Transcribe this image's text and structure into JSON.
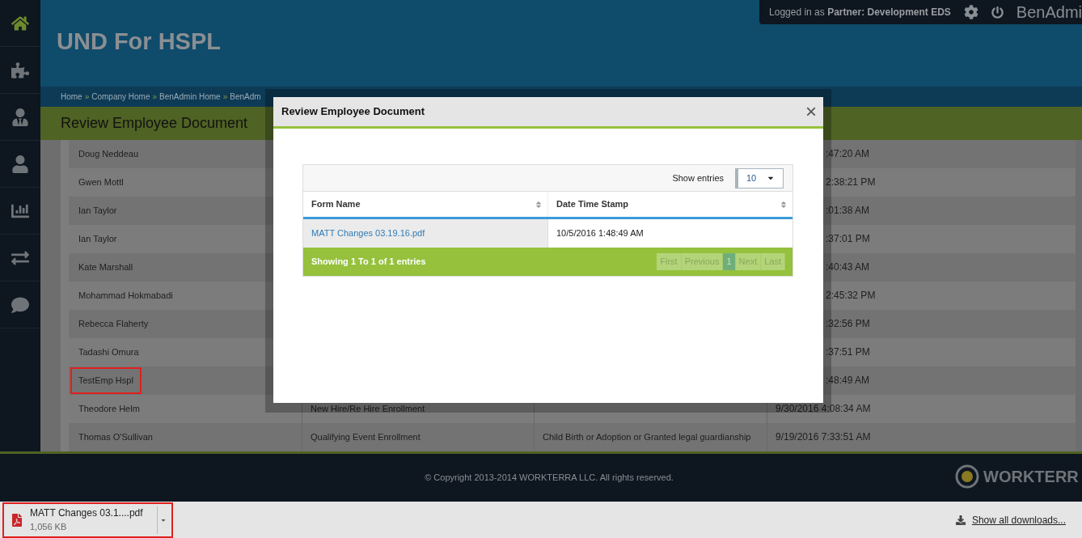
{
  "sidebar": {
    "items": [
      {
        "selected": true
      },
      {
        "selected": false
      },
      {
        "selected": false
      },
      {
        "selected": false
      },
      {
        "selected": false
      },
      {
        "selected": false
      },
      {
        "selected": false
      }
    ]
  },
  "header": {
    "title": "UND For HSPL",
    "login_prefix": "Logged in as",
    "login_role": "Partner:",
    "login_name": "Development EDS",
    "app_name": "BenAdmi"
  },
  "breadcrumb": [
    {
      "label": "Home",
      "separator": "»"
    },
    {
      "label": "Company Home",
      "separator": "»"
    },
    {
      "label": "BenAdmin Home",
      "separator": "»"
    },
    {
      "label": "BenAdm"
    }
  ],
  "page_title": "Review Employee Document",
  "table": {
    "rows": [
      {
        "name": "Doug Neddeau",
        "form": "",
        "event": "",
        "time": ":47:20 AM",
        "covered": true,
        "highlighted": false
      },
      {
        "name": "Gwen Mottl",
        "form": "",
        "event": "",
        "time": "2:38:21 PM",
        "covered": true,
        "highlighted": false
      },
      {
        "name": "Ian Taylor",
        "form": "",
        "event": "",
        "time": ":01:38 AM",
        "covered": true,
        "highlighted": false
      },
      {
        "name": "Ian Taylor",
        "form": "",
        "event": "",
        "time": ":37:01 PM",
        "covered": true,
        "highlighted": false
      },
      {
        "name": "Kate Marshall",
        "form": "",
        "event": "",
        "time": ":40:43 AM",
        "covered": true,
        "highlighted": false
      },
      {
        "name": "Mohammad Hokmabadi",
        "form": "",
        "event": "",
        "time": "2:45:32 PM",
        "covered": true,
        "highlighted": false
      },
      {
        "name": "Rebecca Flaherty",
        "form": "",
        "event": "",
        "time": ":32:56 PM",
        "covered": true,
        "highlighted": false
      },
      {
        "name": "Tadashi Omura",
        "form": "",
        "event": "",
        "time": ":37:51 PM",
        "covered": true,
        "highlighted": false
      },
      {
        "name": "TestEmp Hspl",
        "form": "",
        "event": "",
        "time": ":48:49 AM",
        "covered": true,
        "highlighted": true
      },
      {
        "name": "Theodore Helm",
        "form": "New Hire/Re Hire Enrollment",
        "event": "",
        "time": "9/30/2016 4:08:34 AM",
        "covered": false,
        "highlighted": false
      },
      {
        "name": "Thomas O'Sullivan",
        "form": "Qualifying Event Enrollment",
        "event": "Child Birth or Adoption or Granted legal guardianship",
        "time": "9/19/2016 7:33:51 AM",
        "covered": false,
        "highlighted": false
      }
    ]
  },
  "footer": {
    "copyright": "© Copyright 2013-2014 WORKTERRA LLC. All rights reserved.",
    "logo": "WORKTERR"
  },
  "modal": {
    "title": "Review Employee Document",
    "close": "×",
    "show_entries_label": "Show entries",
    "page_size": "10",
    "columns": [
      "Form Name",
      "Date Time Stamp"
    ],
    "rows": [
      {
        "form_name": "MATT Changes 03.19.16.pdf",
        "timestamp": "10/5/2016 1:48:49 AM"
      }
    ],
    "info": "Showing 1 To 1 of 1 entries",
    "pager": [
      {
        "label": "First",
        "selected": false
      },
      {
        "label": "Previous",
        "selected": false
      },
      {
        "label": "1",
        "selected": true
      },
      {
        "label": "Next",
        "selected": false
      },
      {
        "label": "Last",
        "selected": false
      }
    ]
  },
  "downloads": {
    "items": [
      {
        "name": "MATT Changes 03.1....pdf",
        "size": "1,056 KB",
        "highlighted": true
      }
    ],
    "show_all": "Show all downloads..."
  }
}
